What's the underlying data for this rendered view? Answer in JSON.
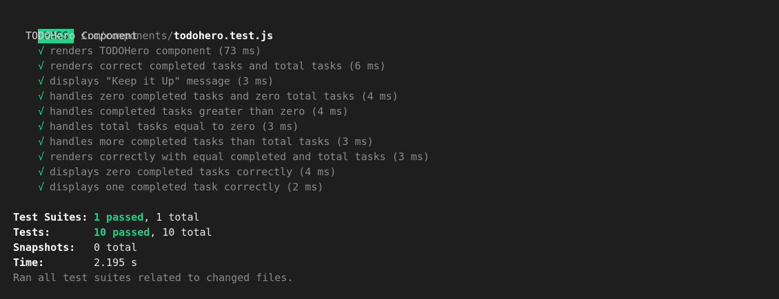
{
  "header": {
    "badge": "PASS",
    "path_dir": "src/components/",
    "path_file": "todohero.test.js"
  },
  "suite": {
    "name": "TODOHero Component",
    "check_mark": "√",
    "tests": [
      "renders TODOHero component (73 ms)",
      "renders correct completed tasks and total tasks (6 ms)",
      "displays \"Keep it Up\" message (3 ms)",
      "handles zero completed tasks and zero total tasks (4 ms)",
      "handles completed tasks greater than zero (4 ms)",
      "handles total tasks equal to zero (3 ms)",
      "handles more completed tasks than total tasks (3 ms)",
      "renders correctly with equal completed and total tasks (3 ms)",
      "displays zero completed tasks correctly (4 ms)",
      "displays one completed task correctly (2 ms)"
    ]
  },
  "summary": {
    "suites_label": "Test Suites:",
    "suites_passed": "1 passed",
    "suites_total": ", 1 total",
    "tests_label": "Tests:",
    "tests_passed": "10 passed",
    "tests_total": ", 10 total",
    "snapshots_label": "Snapshots:",
    "snapshots_value": "0 total",
    "time_label": "Time:",
    "time_value": "2.195 s",
    "footer": "Ran all test suites related to changed files."
  },
  "colors": {
    "background": "#1e1e1e",
    "pass_green": "#23d18b",
    "dim_text": "#8a8a8a"
  }
}
